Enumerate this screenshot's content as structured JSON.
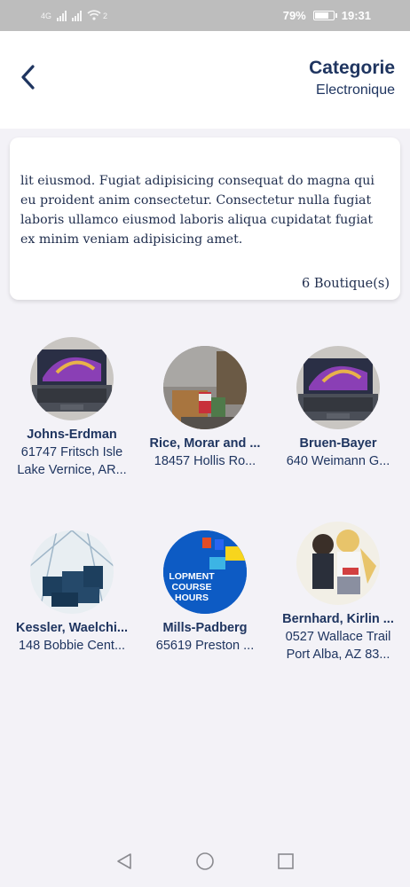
{
  "status_bar": {
    "network": "4G",
    "badge": "2",
    "battery": "79%",
    "battery_level": 0.79,
    "time": "19:31"
  },
  "header": {
    "title": "Categorie",
    "subtitle": "Electronique"
  },
  "description": {
    "text": "lit eiusmod. Fugiat adipisicing consequat do magna qui eu proident anim consectetur. Consectetur nulla fugiat laboris ullamco eiusmod laboris aliqua cupidatat fugiat ex minim veniam adipisicing amet.",
    "count_label": "6 Boutique(s)"
  },
  "shops": [
    {
      "name": "Johns-Erdman",
      "address_line1": "61747 Fritsch Isle",
      "address_line2": "Lake Vernice, AR...",
      "image": "laptop"
    },
    {
      "name": "Rice, Morar and ...",
      "address_line1": "18457 Hollis Ro...",
      "address_line2": "",
      "image": "room-photo"
    },
    {
      "name": "Bruen-Bayer",
      "address_line1": "640 Weimann G...",
      "address_line2": "",
      "image": "laptop"
    },
    {
      "name": "Kessler, Waelchi...",
      "address_line1": "148 Bobbie Cent...",
      "address_line2": "",
      "image": "hardware"
    },
    {
      "name": "Mills-Padberg",
      "address_line1": "65619 Preston ...",
      "address_line2": "",
      "image": "course-banner",
      "image_text": [
        "LOPMENT",
        "COURSE",
        "HOURS"
      ]
    },
    {
      "name": "Bernhard, Kirlin ...",
      "address_line1": "0527 Wallace Trail",
      "address_line2": "Port Alba, AZ 83...",
      "image": "anime-art"
    }
  ],
  "nav": {
    "back": "back-triangle-icon",
    "home": "home-circle-icon",
    "recents": "recents-square-icon"
  },
  "colors": {
    "primary": "#1f3560",
    "background": "#f3f2f7",
    "card": "#ffffff"
  }
}
